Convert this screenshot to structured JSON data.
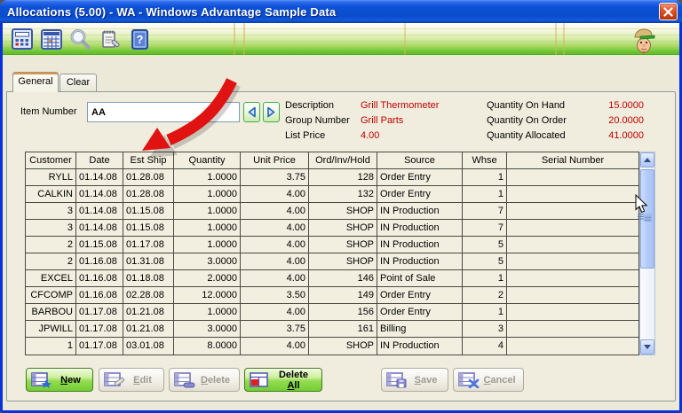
{
  "window": {
    "title": "Allocations (5.00) - WA - Windows Advantage Sample Data"
  },
  "toolbar": {
    "icons": [
      {
        "name": "calculator-icon"
      },
      {
        "name": "calendar-icon"
      },
      {
        "name": "search-icon"
      },
      {
        "name": "notes-icon"
      },
      {
        "name": "help-icon"
      }
    ],
    "mascot": "man-with-cap-icon"
  },
  "tabs": {
    "general": "General",
    "clear": "Clear"
  },
  "form": {
    "item_number_label": "Item Number",
    "item_number_value": "AA",
    "fields_left": [
      {
        "label": "Description",
        "value": "Grill Thermometer"
      },
      {
        "label": "Group Number",
        "value": "Grill Parts"
      },
      {
        "label": "List Price",
        "value": "4.00"
      }
    ],
    "fields_right": [
      {
        "label": "Quantity On Hand",
        "value": "15.0000"
      },
      {
        "label": "Quantity On Order",
        "value": "20.0000"
      },
      {
        "label": "Quantity Allocated",
        "value": "41.0000"
      }
    ]
  },
  "colors": {
    "value_red": "#C00000",
    "toolbar_green": "#57BD22",
    "titlebar_blue": "#0A4CCB",
    "button_green": "#93DC52"
  },
  "table": {
    "columns": [
      "Customer",
      "Date",
      "Est Ship",
      "Quantity",
      "Unit Price",
      "Ord/Inv/Hold",
      "Source",
      "Whse",
      "Serial Number"
    ],
    "rows": [
      [
        "RYLL",
        "01.14.08",
        "01.28.08",
        "1.0000",
        "3.75",
        "128",
        "Order Entry",
        "1",
        ""
      ],
      [
        "CALKIN",
        "01.14.08",
        "01.28.08",
        "1.0000",
        "4.00",
        "132",
        "Order Entry",
        "1",
        ""
      ],
      [
        "3",
        "01.14.08",
        "01.15.08",
        "1.0000",
        "4.00",
        "SHOP",
        "IN Production",
        "7",
        ""
      ],
      [
        "3",
        "01.14.08",
        "01.15.08",
        "1.0000",
        "4.00",
        "SHOP",
        "IN Production",
        "7",
        ""
      ],
      [
        "2",
        "01.15.08",
        "01.17.08",
        "1.0000",
        "4.00",
        "SHOP",
        "IN Production",
        "5",
        ""
      ],
      [
        "2",
        "01.16.08",
        "01.31.08",
        "3.0000",
        "4.00",
        "SHOP",
        "IN Production",
        "5",
        ""
      ],
      [
        "EXCEL",
        "01.16.08",
        "01.18.08",
        "2.0000",
        "4.00",
        "146",
        "Point of Sale",
        "1",
        ""
      ],
      [
        "CFCOMP",
        "01.16.08",
        "02.28.08",
        "12.0000",
        "3.50",
        "149",
        "Order Entry",
        "2",
        ""
      ],
      [
        "BARBOU",
        "01.17.08",
        "01.21.08",
        "1.0000",
        "4.00",
        "156",
        "Order Entry",
        "1",
        ""
      ],
      [
        "JPWILL",
        "01.17.08",
        "01.21.08",
        "3.0000",
        "3.75",
        "161",
        "Billing",
        "3",
        ""
      ],
      [
        "1",
        "01.17.08",
        "03.01.08",
        "8.0000",
        "4.00",
        "SHOP",
        "IN Production",
        "4",
        ""
      ]
    ]
  },
  "buttons": {
    "new": {
      "pre": "",
      "accel": "N",
      "post": "ew"
    },
    "edit": {
      "pre": "",
      "accel": "E",
      "post": "dit"
    },
    "delete": {
      "pre": "",
      "accel": "D",
      "post": "elete"
    },
    "delete_all": {
      "pre": "Delete ",
      "accel": "A",
      "post": "ll"
    },
    "save": {
      "pre": "",
      "accel": "S",
      "post": "ave"
    },
    "cancel": {
      "pre": "",
      "accel": "C",
      "post": "ancel"
    }
  }
}
